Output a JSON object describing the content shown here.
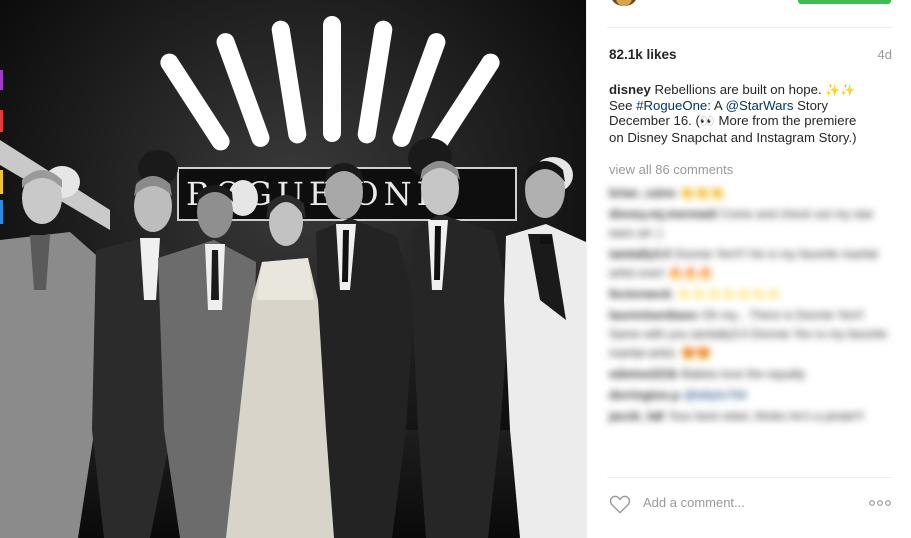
{
  "post": {
    "likes": "82.1k likes",
    "time_ago": "4d",
    "caption": {
      "username": "disney",
      "line1": "Rebellions are built on hope.",
      "line2_prefix": "See",
      "hashtag": "#RogueOne",
      "line2_mid": ": A",
      "mention": "@StarWars",
      "line2_suffix": "Story",
      "line3": "December 16.",
      "line3_suffix": "More from the premiere",
      "line4": "on Disney Snapchat and Instagram Story.)"
    },
    "view_all": "view all 86 comments",
    "comments": [
      {
        "user": "brian_caine",
        "text": "",
        "emoji": "👏👏👏"
      },
      {
        "user": "disney.mj.mermaid",
        "text": "Come and check out my star wars art :)"
      },
      {
        "user": "iamtally3.0",
        "text": "Donnie Yen!!! He is my favorite martial artist ever!",
        "emoji": "🔥🔥🔥"
      },
      {
        "user": "fectorweck",
        "text": "",
        "emoji": "✨✨✨✨✨✨✨"
      },
      {
        "user": "laurentsenbaso",
        "text": "Oh my... There is Donnie Yen!! Same with you iamtally3.0 Donnie Yen is my favorite martial artist.",
        "emoji": "😍😍"
      },
      {
        "user": "edmise221b",
        "text": "Babies love the equally"
      },
      {
        "user": "derrington.p",
        "text": "",
        "mention": "@billyfu794"
      },
      {
        "user": "jacob_la8",
        "text": "Your best rebel, thinks he's a pirate!!!"
      }
    ],
    "add_comment_placeholder": "Add a comment...",
    "more_label": "•••"
  },
  "icons": {
    "heart": "heart-outline-icon",
    "more": "more-options-icon",
    "sparkle": "sparkles-emoji",
    "eyes": "eyes-emoji"
  },
  "colors": {
    "link": "#003569",
    "muted": "#999999",
    "text": "#262626",
    "follow_green": "#3dbb55"
  }
}
